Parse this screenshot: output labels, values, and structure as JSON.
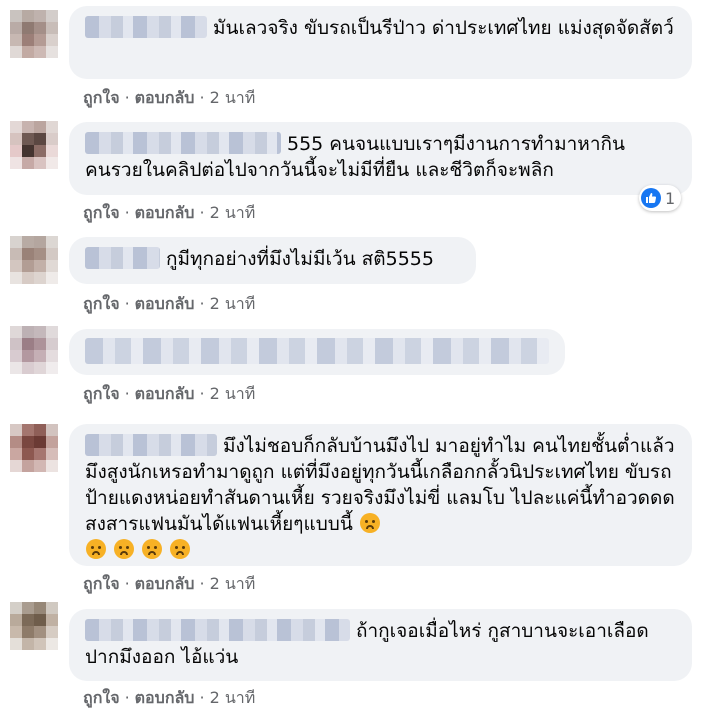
{
  "comments": [
    {
      "text": "มันเลวจริง ขับรถเป็นรีป่าว ด่าประเทศไทย แม่งสุดจัดสัตว์",
      "like_label": "ถูกใจ",
      "reply_label": "ตอบกลับ",
      "time": "2 นาที"
    },
    {
      "text": "555 คนจนแบบเราๆมีงานการทำมาหากินคนรวยในคลิปต่อไปจากวันนี้จะไม่มีที่ยืน และชีวิตก็จะพลิก",
      "like_label": "ถูกใจ",
      "reply_label": "ตอบกลับ",
      "time": "2 นาที",
      "reaction_count": "1"
    },
    {
      "text": "กูมีทุกอย่างที่มึงไม่มีเว้น สติ5555",
      "like_label": "ถูกใจ",
      "reply_label": "ตอบกลับ",
      "time": "2 นาที"
    },
    {
      "text": "",
      "like_label": "ถูกใจ",
      "reply_label": "ตอบกลับ",
      "time": "2 นาที"
    },
    {
      "text": "มึงไม่ชอบก็กลับบ้านมึงไป มาอยู่ทำไม คนไทยชั้นต่ำแล้วมึงสูงนักเหรอทำมาดูถูก แต่ที่มึงอยู่ทุกวันนี้เกลือกกลั้วนิประเทศไทย ขับรถป้ายแดงหน่อยทำสันดานเหี้ย รวยจริงมึงไม่ขี่ แลมโบ ไปละแค่นี้ทำอวดดด สงสารแฟนมันได้แฟนเหี้ยๆแบบนี้",
      "like_label": "ถูกใจ",
      "reply_label": "ตอบกลับ",
      "time": "2 นาที"
    },
    {
      "text": "ถ้ากูเจอเมื่อไหร่ กูสาบานจะเอาเลือดปากมึงออก ไอ้แว่น",
      "like_label": "ถูกใจ",
      "reply_label": "ตอบกลับ",
      "time": "2 นาที"
    }
  ],
  "colors": {
    "bubble_bg": "#f0f2f5",
    "meta_text": "#65676b",
    "like_blue": "#1877f2",
    "emoji_yellow": "#f7b125"
  },
  "icons": {
    "reaction": "like-thumb-icon",
    "emoji": "angry-face-icon"
  }
}
